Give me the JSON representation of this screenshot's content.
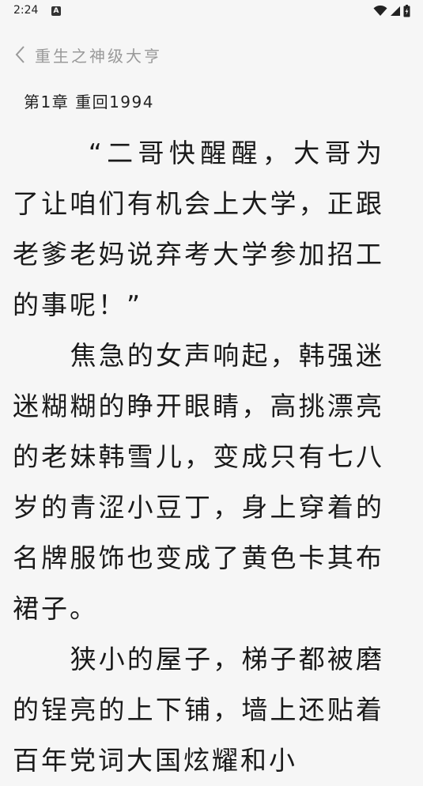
{
  "status_bar": {
    "time": "2:24",
    "app_icon_letter": "A"
  },
  "header": {
    "book_title": "重生之神级大亨"
  },
  "chapter": {
    "title": "第1章 重回1994"
  },
  "paragraphs": [
    "“二哥快醒醒，大哥为了让咱们有机会上大学，正跟老爹老妈说弃考大学参加招工的事呢！”",
    "焦急的女声响起，韩强迷迷糊糊的睁开眼睛，高挑漂亮的老妹韩雪儿，变成只有七八岁的青涩小豆丁，身上穿着的名牌服饰也变成了黄色卡其布裙子。",
    "狭小的屋子，梯子都被磨的锃亮的上下铺，墙上还贴着百年党词大国炫耀和小"
  ],
  "colors": {
    "background": "#f6f6f6",
    "body_text": "#1a1a1a",
    "muted_title": "#999999"
  }
}
